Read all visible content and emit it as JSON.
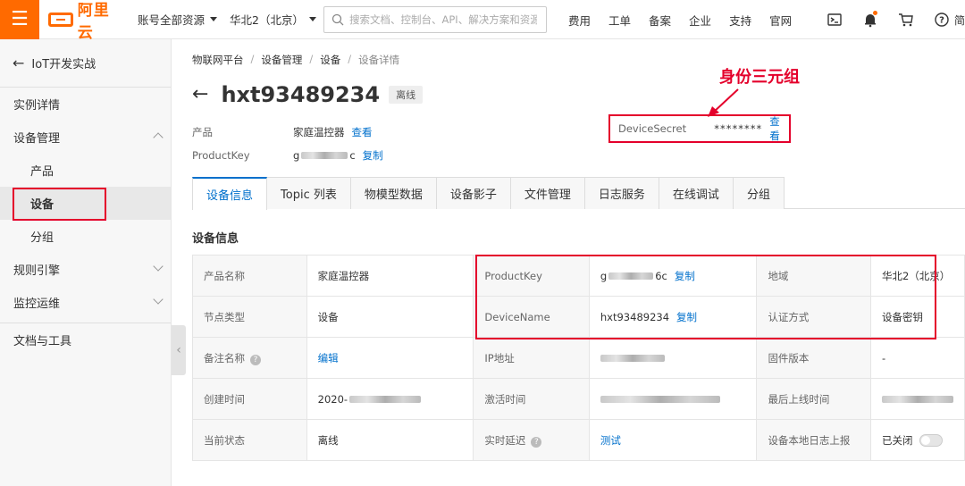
{
  "topbar": {
    "logo": "阿里云",
    "account_scope": "账号全部资源",
    "region": "华北2（北京）",
    "search_placeholder": "搜索文档、控制台、API、解决方案和资源",
    "links": [
      "费用",
      "工单",
      "备案",
      "企业",
      "支持",
      "官网"
    ],
    "more_label": "简"
  },
  "sidebar": {
    "back_label": "IoT开发实战",
    "items": [
      {
        "label": "实例详情",
        "level": 1
      },
      {
        "label": "设备管理",
        "level": 1,
        "expanded": true
      },
      {
        "label": "产品",
        "level": 2
      },
      {
        "label": "设备",
        "level": 2,
        "active": true
      },
      {
        "label": "分组",
        "level": 2
      },
      {
        "label": "规则引擎",
        "level": 1,
        "expanded": false
      },
      {
        "label": "监控运维",
        "level": 1,
        "expanded": false
      },
      {
        "label": "文档与工具",
        "level": 1
      }
    ]
  },
  "breadcrumb": [
    "物联网平台",
    "设备管理",
    "设备",
    "设备详情"
  ],
  "device": {
    "name": "hxt93489234",
    "status": "离线",
    "product_label": "产品",
    "product_value": "家庭温控器",
    "view_label": "查看",
    "productkey_label": "ProductKey",
    "productkey_value": "g",
    "productkey_suffix": "c",
    "copy_label": "复制",
    "secret_label": "DeviceSecret",
    "secret_value": "********",
    "secret_view": "查看"
  },
  "annotation": "身份三元组",
  "tabs": [
    "设备信息",
    "Topic 列表",
    "物模型数据",
    "设备影子",
    "文件管理",
    "日志服务",
    "在线调试",
    "分组"
  ],
  "section_title": "设备信息",
  "info": {
    "product_name_k": "产品名称",
    "product_name_v": "家庭温控器",
    "productkey_k": "ProductKey",
    "productkey_v_prefix": "g",
    "productkey_v_suffix": "6c",
    "region_k": "地域",
    "region_v": "华北2（北京）",
    "node_type_k": "节点类型",
    "node_type_v": "设备",
    "devicename_k": "DeviceName",
    "devicename_v": "hxt93489234",
    "auth_k": "认证方式",
    "auth_v": "设备密钥",
    "remark_k": "备注名称",
    "remark_v": "编辑",
    "ip_k": "IP地址",
    "firmware_k": "固件版本",
    "firmware_v": "-",
    "created_k": "创建时间",
    "created_v_prefix": "2020-",
    "activated_k": "激活时间",
    "last_online_k": "最后上线时间",
    "state_k": "当前状态",
    "state_v": "离线",
    "latency_k": "实时延迟",
    "latency_v": "测试",
    "local_log_k": "设备本地日志上报",
    "local_log_v": "已关闭",
    "copy_label": "复制"
  }
}
